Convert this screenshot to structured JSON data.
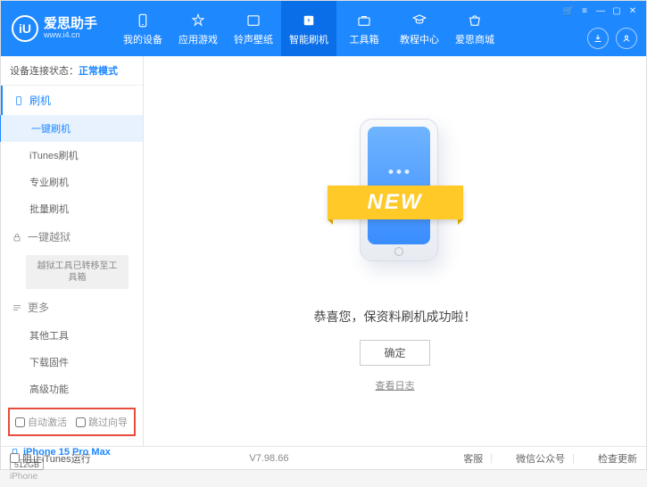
{
  "logo": {
    "mark": "iU",
    "title": "爱思助手",
    "subtitle": "www.i4.cn"
  },
  "nav": {
    "items": [
      "我的设备",
      "应用游戏",
      "铃声壁纸",
      "智能刷机",
      "工具箱",
      "教程中心",
      "爱思商城"
    ],
    "active_index": 3
  },
  "status": {
    "label": "设备连接状态：",
    "value": "正常模式"
  },
  "sidebar": {
    "group_flash": "刷机",
    "items_flash": [
      "一键刷机",
      "iTunes刷机",
      "专业刷机",
      "批量刷机"
    ],
    "group_jailbreak": "一键越狱",
    "jailbreak_note": "越狱工具已转移至工具箱",
    "group_more": "更多",
    "items_more": [
      "其他工具",
      "下载固件",
      "高级功能"
    ],
    "cb_auto_activate": "自动激活",
    "cb_skip_guide": "跳过向导"
  },
  "device": {
    "name": "iPhone 15 Pro Max",
    "capacity": "512GB",
    "type": "iPhone"
  },
  "main": {
    "ribbon": "NEW",
    "message": "恭喜您，保资料刷机成功啦！",
    "ok": "确定",
    "log_link": "查看日志"
  },
  "footer": {
    "block_itunes": "阻止iTunes运行",
    "version": "V7.98.66",
    "support": "客服",
    "wechat": "微信公众号",
    "update": "检查更新"
  }
}
